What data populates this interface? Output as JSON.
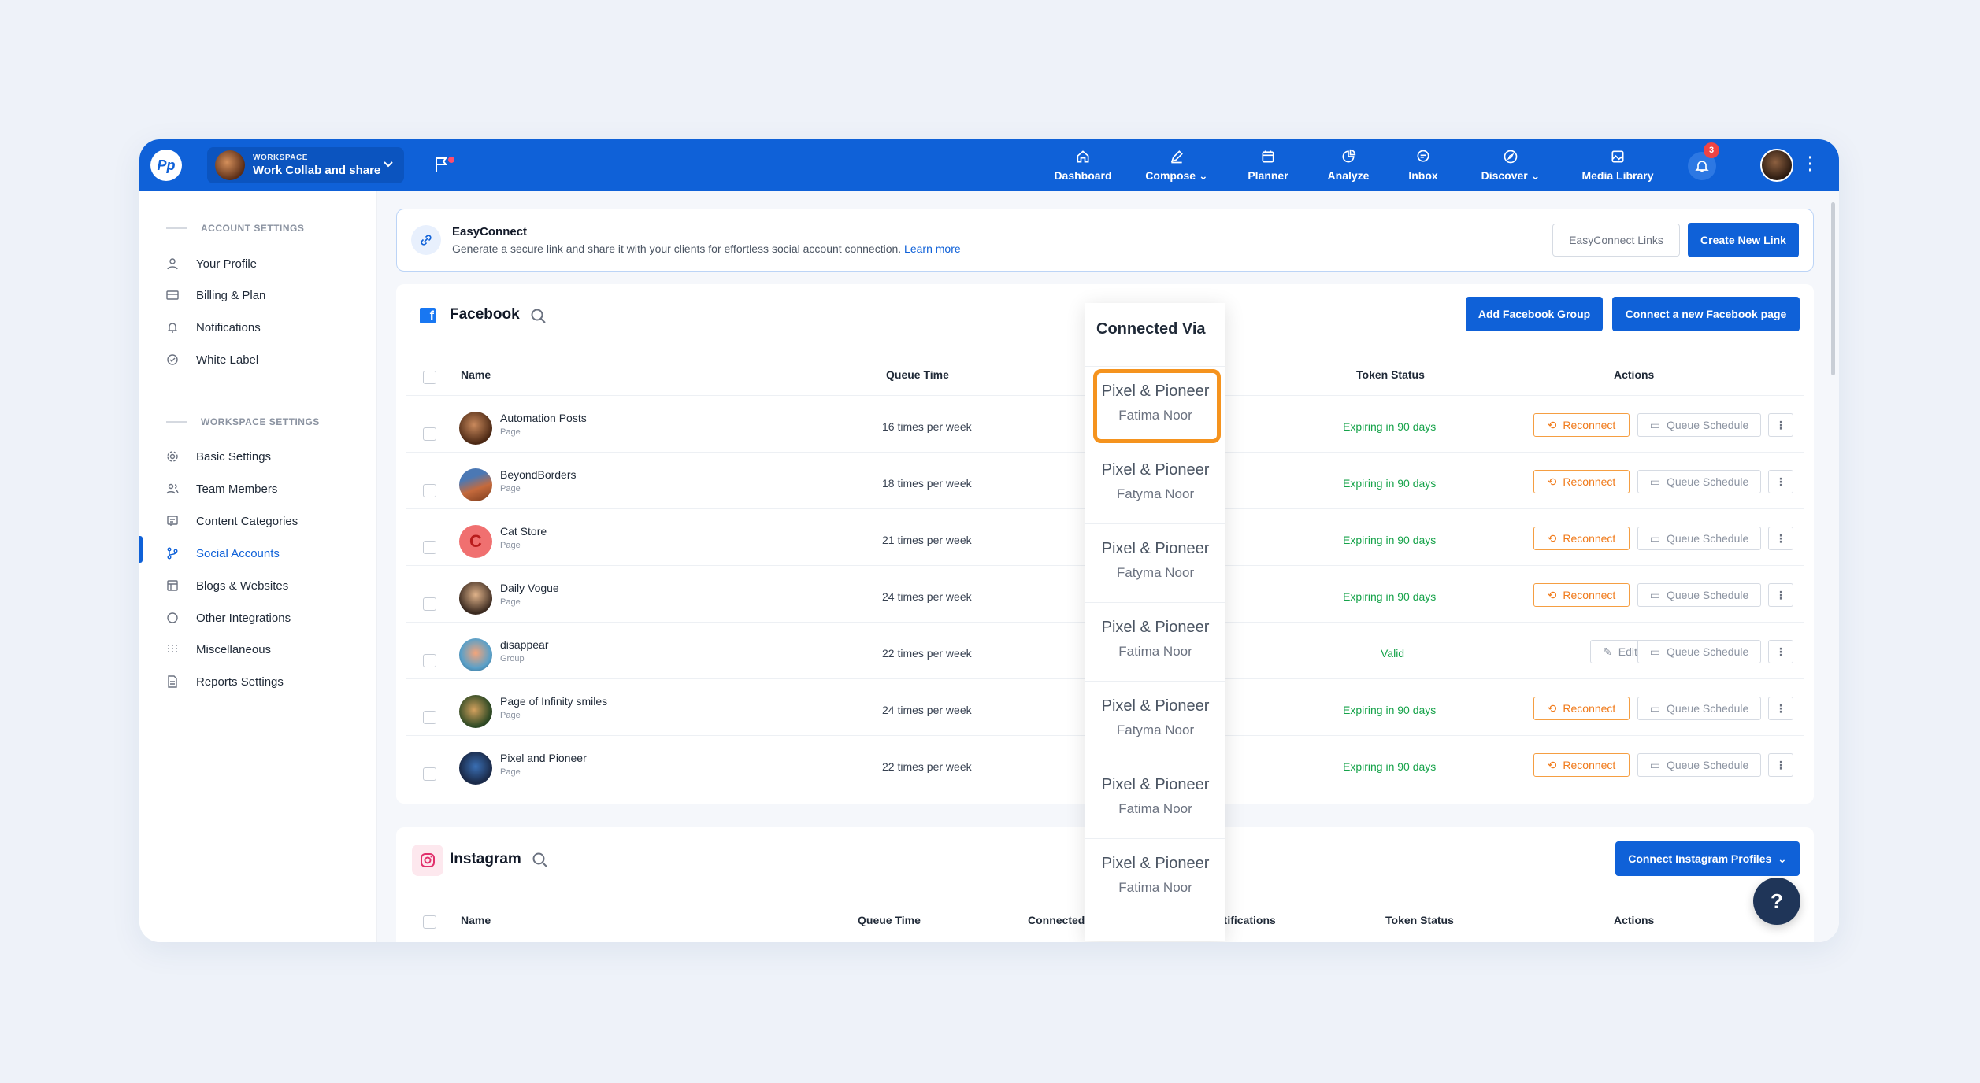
{
  "topbar": {
    "workspace_small": "WORKSPACE",
    "workspace_name": "Work Collab and share",
    "nav": [
      {
        "label": "Dashboard",
        "icon": "home-icon"
      },
      {
        "label": "Compose",
        "icon": "pencil-icon"
      },
      {
        "label": "Planner",
        "icon": "calendar-icon"
      },
      {
        "label": "Analyze",
        "icon": "chart-pie-icon"
      },
      {
        "label": "Inbox",
        "icon": "chat-icon"
      },
      {
        "label": "Discover",
        "icon": "compass-icon"
      },
      {
        "label": "Media Library",
        "icon": "image-icon"
      }
    ],
    "notifications_count": "3"
  },
  "sidebar": {
    "account_settings": "ACCOUNT SETTINGS",
    "account_items": [
      "Your Profile",
      "Billing & Plan",
      "Notifications",
      "White Label"
    ],
    "workspace_settings": "WORKSPACE SETTINGS",
    "workspace_items": [
      "Basic Settings",
      "Team Members",
      "Content Categories",
      "Social Accounts",
      "Blogs & Websites",
      "Other Integrations",
      "Miscellaneous",
      "Reports Settings"
    ],
    "active": "Social Accounts"
  },
  "easyconnect": {
    "title": "EasyConnect",
    "description": "Generate a secure link and share it with your clients for effortless social account connection.",
    "learn_more": "Learn more",
    "links_button": "EasyConnect Links",
    "create_button": "Create New Link"
  },
  "facebook": {
    "title": "Facebook",
    "add_group_button": "Add Facebook Group",
    "connect_page_button": "Connect a new Facebook page",
    "columns": {
      "name": "Name",
      "queue": "Queue Time",
      "token": "Token Status",
      "actions": "Actions"
    },
    "rows": [
      {
        "name": "Automation Posts",
        "type": "Page",
        "queue": "16 times per week",
        "token": "Expiring in 90 days",
        "action": "Reconnect"
      },
      {
        "name": "BeyondBorders",
        "type": "Page",
        "queue": "18 times per week",
        "token": "Expiring in 90 days",
        "action": "Reconnect"
      },
      {
        "name": "Cat Store",
        "type": "Page",
        "queue": "21 times per week",
        "token": "Expiring in 90 days",
        "action": "Reconnect"
      },
      {
        "name": "Daily Vogue",
        "type": "Page",
        "queue": "24 times per week",
        "token": "Expiring in 90 days",
        "action": "Reconnect"
      },
      {
        "name": "disappear",
        "type": "Group",
        "queue": "22 times per week",
        "token": "Valid",
        "action": "Edit"
      },
      {
        "name": "Page of Infinity smiles",
        "type": "Page",
        "queue": "24 times per week",
        "token": "Expiring in 90 days",
        "action": "Reconnect"
      },
      {
        "name": "Pixel and Pioneer",
        "type": "Page",
        "queue": "22 times per week",
        "token": "Expiring in 90 days",
        "action": "Reconnect"
      }
    ],
    "queue_schedule_label": "Queue Schedule"
  },
  "connected_via": {
    "header": "Connected Via",
    "items": [
      {
        "name": "Pixel & Pioneer",
        "user": "Fatima Noor"
      },
      {
        "name": "Pixel & Pioneer",
        "user": "Fatyma Noor"
      },
      {
        "name": "Pixel & Pioneer",
        "user": "Fatyma Noor"
      },
      {
        "name": "Pixel & Pioneer",
        "user": "Fatima Noor"
      },
      {
        "name": "Pixel & Pioneer",
        "user": "Fatyma Noor"
      },
      {
        "name": "Pixel & Pioneer",
        "user": "Fatima Noor"
      },
      {
        "name": "Pixel & Pioneer",
        "user": "Fatima Noor"
      }
    ]
  },
  "instagram": {
    "title": "Instagram",
    "connect_button": "Connect Instagram Profiles",
    "columns": {
      "name": "Name",
      "queue": "Queue Time",
      "connected": "Connected Via",
      "notifications": "Notifications",
      "token": "Token Status",
      "actions": "Actions"
    }
  },
  "help": "?",
  "colors": {
    "primary": "#0f61d8",
    "valid": "#16a34a",
    "reconnect": "#f07a1a",
    "highlight": "#f5931e"
  }
}
